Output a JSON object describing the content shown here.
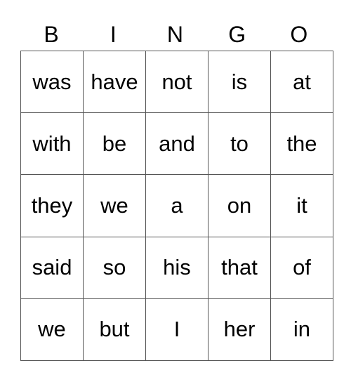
{
  "header": [
    "B",
    "I",
    "N",
    "G",
    "O"
  ],
  "rows": [
    [
      "was",
      "have",
      "not",
      "is",
      "at"
    ],
    [
      "with",
      "be",
      "and",
      "to",
      "the"
    ],
    [
      "they",
      "we",
      "a",
      "on",
      "it"
    ],
    [
      "said",
      "so",
      "his",
      "that",
      "of"
    ],
    [
      "we",
      "but",
      "I",
      "her",
      "in"
    ]
  ]
}
